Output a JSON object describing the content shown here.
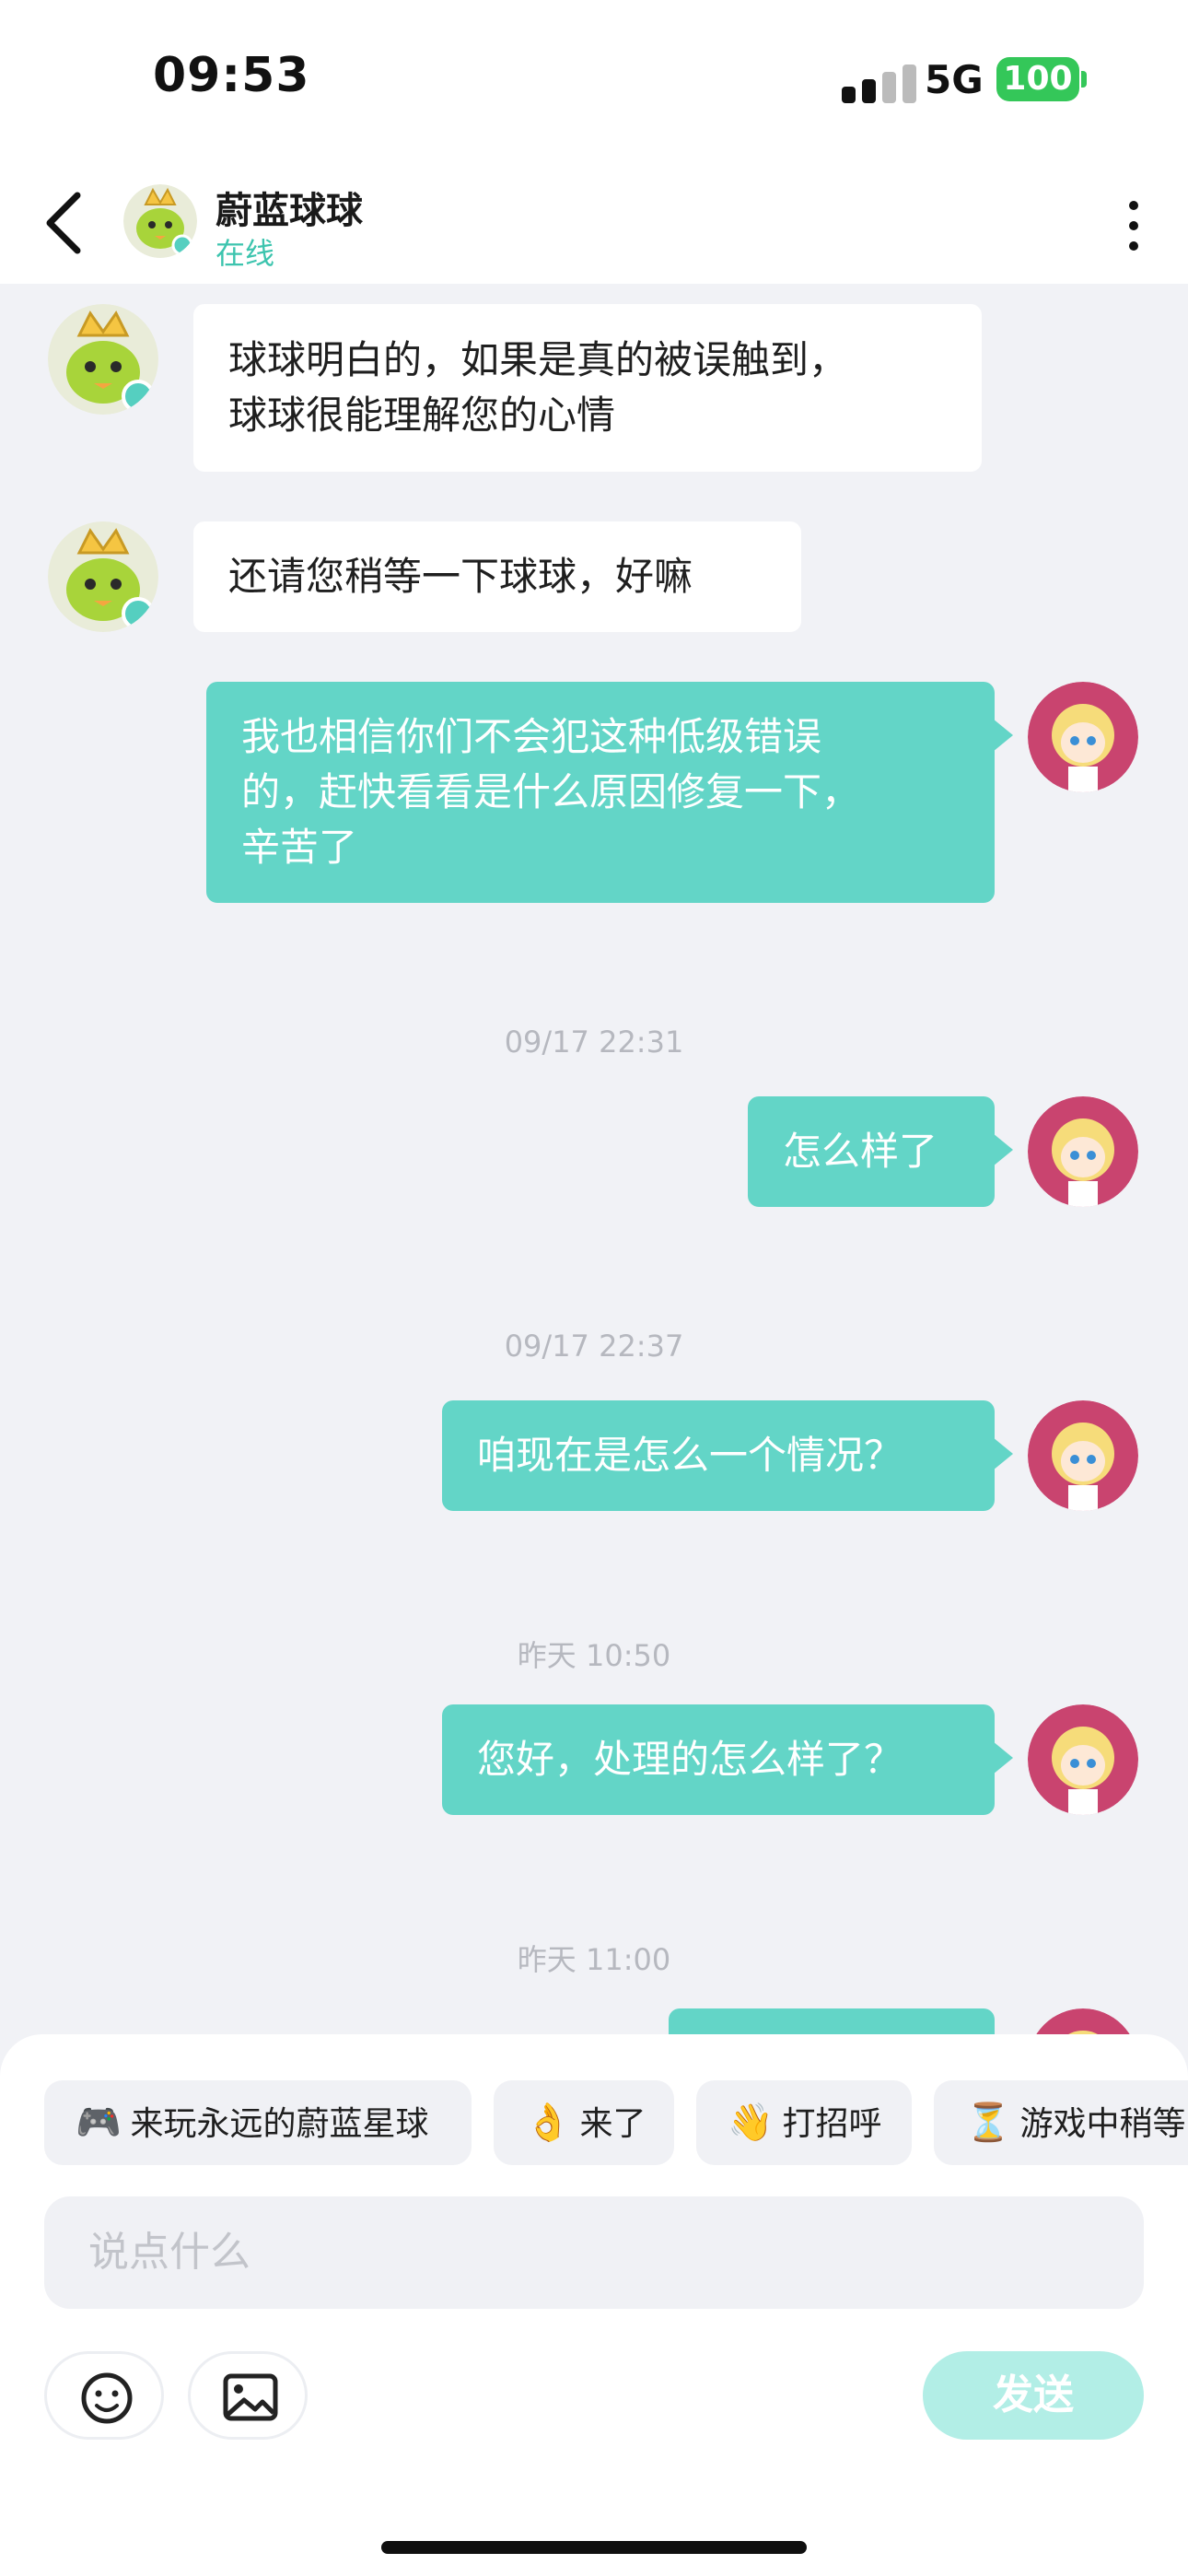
{
  "status_bar": {
    "time": "09:53",
    "network": "5G",
    "battery": "100"
  },
  "header": {
    "name": "蔚蓝球球",
    "status": "在线"
  },
  "messages": [
    {
      "side": "in",
      "lines": [
        "球球明白的，如果是真的被误触到，",
        "球球很能理解您的心情"
      ]
    },
    {
      "side": "in",
      "lines": [
        "还请您稍等一下球球，好嘛"
      ]
    },
    {
      "side": "out",
      "lines": [
        "我也相信你们不会犯这种低级错误",
        "的，赶快看看是什么原因修复一下，",
        "辛苦了"
      ]
    },
    {
      "timestamp": "09/17 22:31"
    },
    {
      "side": "out",
      "lines": [
        "怎么样了"
      ]
    },
    {
      "timestamp": "09/17 22:37"
    },
    {
      "side": "out",
      "lines": [
        "咱现在是怎么一个情况？"
      ]
    },
    {
      "timestamp": "昨天 10:50"
    },
    {
      "side": "out",
      "lines": [
        "您好，处理的怎么样了？"
      ]
    },
    {
      "timestamp": "昨天 11:00"
    }
  ],
  "quick_replies": [
    {
      "icon": "🎮",
      "label": "来玩永远的蔚蓝星球"
    },
    {
      "icon": "👌",
      "label": "来了"
    },
    {
      "icon": "👋",
      "label": "打招呼"
    },
    {
      "icon": "⏳",
      "label": "游戏中稍等"
    }
  ],
  "composer": {
    "placeholder": "说点什么",
    "send_label": "发送"
  },
  "colors": {
    "accent": "#63d5c7",
    "online": "#3cc4ae",
    "send_disabled": "#b2eee6",
    "battery": "#34c759"
  }
}
